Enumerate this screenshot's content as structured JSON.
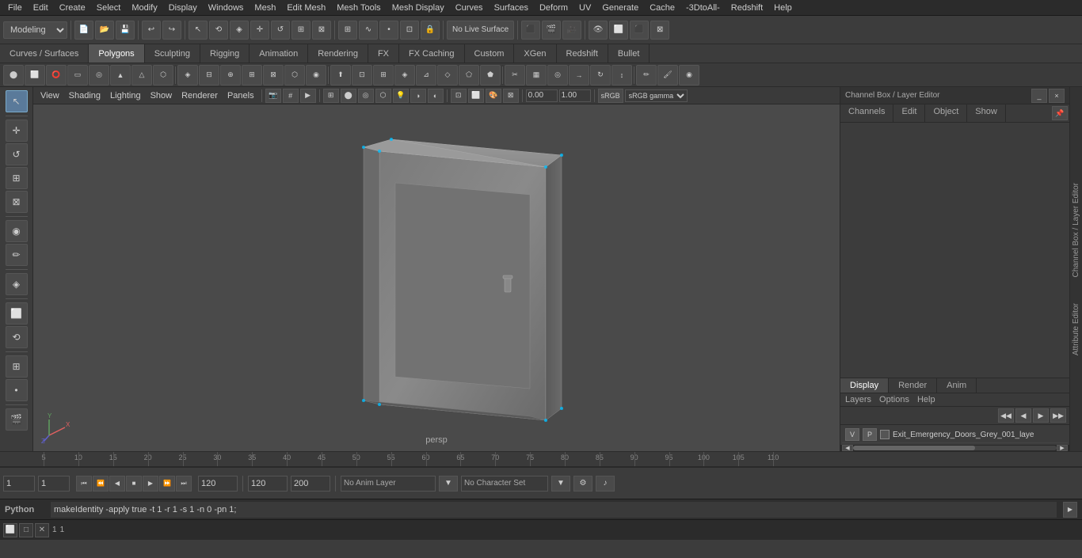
{
  "menu": {
    "items": [
      "File",
      "Edit",
      "Create",
      "Select",
      "Modify",
      "Display",
      "Windows",
      "Mesh",
      "Edit Mesh",
      "Mesh Tools",
      "Mesh Display",
      "Curves",
      "Surfaces",
      "Deform",
      "UV",
      "Generate",
      "Cache",
      "-3DtoAll-",
      "Redshift",
      "Help"
    ]
  },
  "toolbar": {
    "mode_dropdown": "Modeling",
    "live_surface": "No Live Surface",
    "gamma": "sRGB gamma"
  },
  "tabs": {
    "items": [
      "Curves / Surfaces",
      "Polygons",
      "Sculpting",
      "Rigging",
      "Animation",
      "Rendering",
      "FX",
      "FX Caching",
      "Custom",
      "XGen",
      "Redshift",
      "Bullet"
    ],
    "active": "Polygons"
  },
  "viewport": {
    "menus": [
      "View",
      "Shading",
      "Lighting",
      "Show",
      "Renderer",
      "Panels"
    ],
    "persp_label": "persp",
    "rotation_value": "0.00",
    "scale_value": "1.00"
  },
  "right_panel": {
    "title": "Channel Box / Layer Editor",
    "channel_tabs": [
      "Channels",
      "Edit",
      "Object",
      "Show"
    ],
    "layer_tabs": [
      "Display",
      "Render",
      "Anim"
    ],
    "active_layer_tab": "Display",
    "layer_options": [
      "Layers",
      "Options",
      "Help"
    ],
    "layer_entry": {
      "v_label": "V",
      "p_label": "P",
      "name": "Exit_Emergency_Doors_Grey_001_laye"
    }
  },
  "side_tabs": [
    "Channel Box / Layer Editor",
    "Attribute Editor"
  ],
  "timeline": {
    "ticks": [
      5,
      10,
      15,
      20,
      25,
      30,
      35,
      40,
      45,
      50,
      55,
      60,
      65,
      70,
      75,
      80,
      85,
      90,
      95,
      100,
      105,
      110
    ],
    "current_frame": "1",
    "start_frame": "1",
    "end_frame": "120",
    "range_start": "1",
    "range_end": "120",
    "anim_end": "200"
  },
  "bottom_controls": {
    "frame_display": "1",
    "frame_start": "1",
    "frame_end": "120",
    "range_end": "200",
    "no_anim_layer": "No Anim Layer",
    "no_char_set": "No Character Set"
  },
  "cmd_bar": {
    "label": "Python",
    "command": "makeIdentity -apply true -t 1 -r 1 -s 1 -n 0 -pn 1;"
  },
  "status_bar": {
    "item1": "1",
    "item2": "1"
  },
  "icons": {
    "arrow": "↖",
    "move": "✛",
    "rotate": "↺",
    "scale": "⊞",
    "transform": "⊠",
    "select_tool": "↗",
    "lasso": "⟲",
    "paint": "✏",
    "soft": "◉",
    "play": "▶",
    "play_back": "◀",
    "stop": "■",
    "ff": "⏭",
    "rw": "⏮",
    "step_f": "⏩",
    "step_b": "⏪"
  }
}
